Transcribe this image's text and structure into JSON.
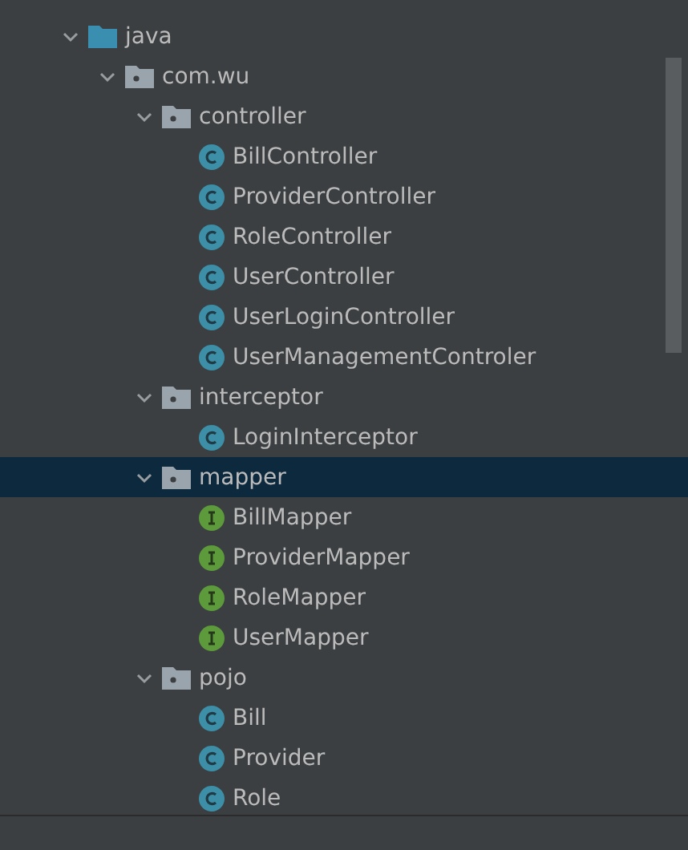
{
  "tree": [
    {
      "label": "java",
      "kind": "source-folder",
      "expanded": true,
      "selected": false,
      "children": [
        {
          "label": "com.wu",
          "kind": "package",
          "expanded": true,
          "selected": false,
          "children": [
            {
              "label": "controller",
              "kind": "package",
              "expanded": true,
              "selected": false,
              "children": [
                {
                  "label": "BillController",
                  "kind": "class",
                  "selected": false
                },
                {
                  "label": "ProviderController",
                  "kind": "class",
                  "selected": false
                },
                {
                  "label": "RoleController",
                  "kind": "class",
                  "selected": false
                },
                {
                  "label": "UserController",
                  "kind": "class",
                  "selected": false
                },
                {
                  "label": "UserLoginController",
                  "kind": "class",
                  "selected": false
                },
                {
                  "label": "UserManagementControler",
                  "kind": "class",
                  "selected": false
                }
              ]
            },
            {
              "label": "interceptor",
              "kind": "package",
              "expanded": true,
              "selected": false,
              "children": [
                {
                  "label": "LoginInterceptor",
                  "kind": "class",
                  "selected": false
                }
              ]
            },
            {
              "label": "mapper",
              "kind": "package",
              "expanded": true,
              "selected": true,
              "children": [
                {
                  "label": "BillMapper",
                  "kind": "interface",
                  "selected": false
                },
                {
                  "label": "ProviderMapper",
                  "kind": "interface",
                  "selected": false
                },
                {
                  "label": "RoleMapper",
                  "kind": "interface",
                  "selected": false
                },
                {
                  "label": "UserMapper",
                  "kind": "interface",
                  "selected": false
                }
              ]
            },
            {
              "label": "pojo",
              "kind": "package",
              "expanded": true,
              "selected": false,
              "children": [
                {
                  "label": "Bill",
                  "kind": "class",
                  "selected": false
                },
                {
                  "label": "Provider",
                  "kind": "class",
                  "selected": false
                },
                {
                  "label": "Role",
                  "kind": "class",
                  "selected": false
                }
              ]
            }
          ]
        }
      ]
    }
  ]
}
